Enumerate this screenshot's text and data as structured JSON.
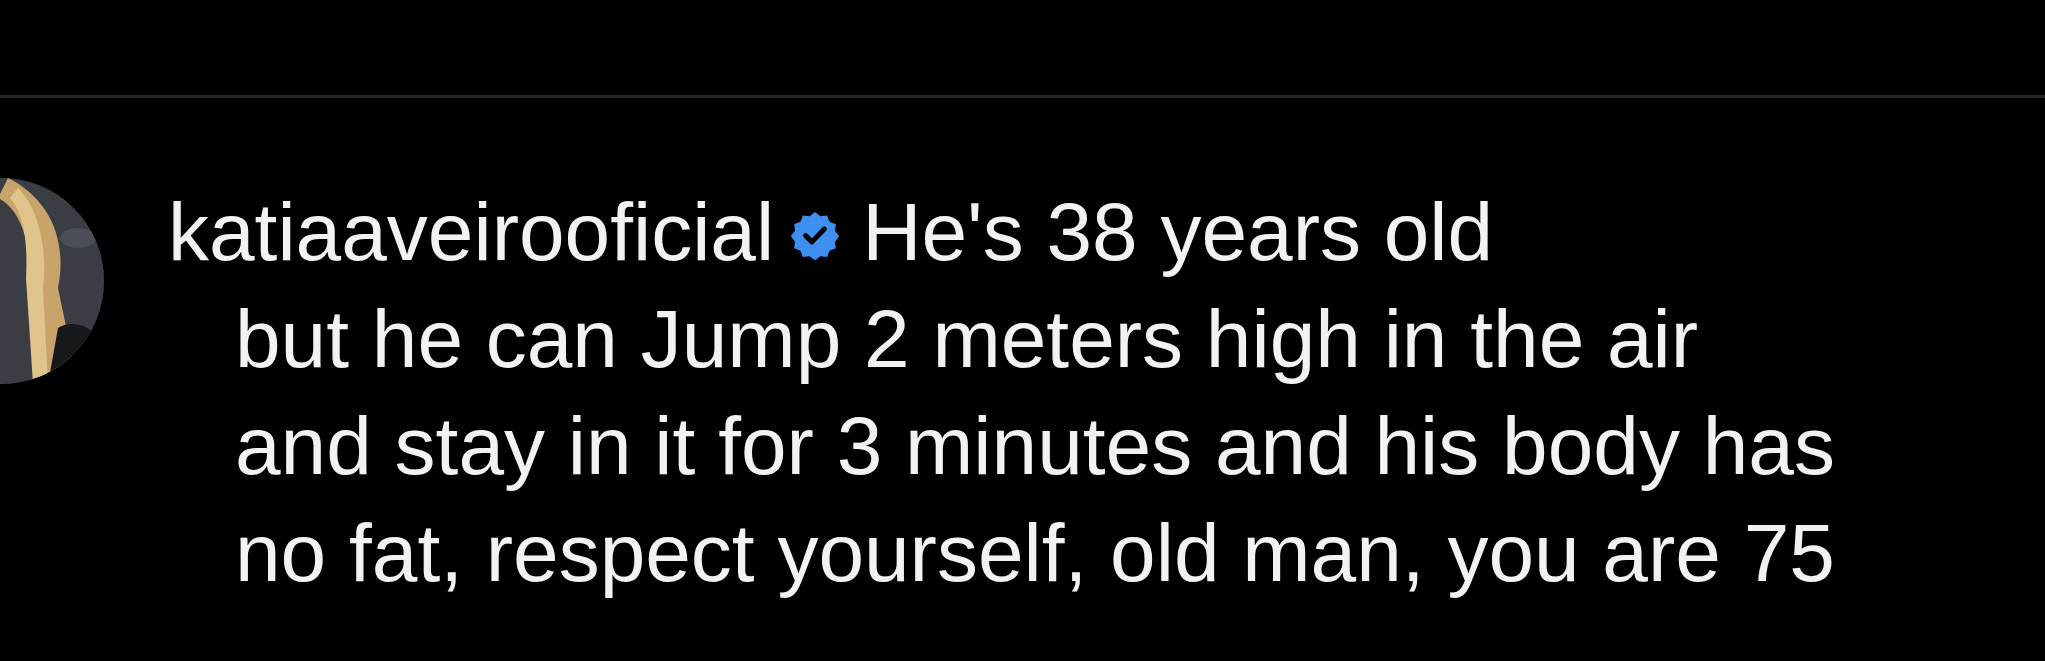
{
  "comment": {
    "username": "katiaaveirooficial",
    "verified": true,
    "text": "He's 38 years old\nbut he can Jump 2 meters high in the air\nand stay in it for 3 minutes and his body has\nno fat, respect yourself, old man, you are 75"
  }
}
